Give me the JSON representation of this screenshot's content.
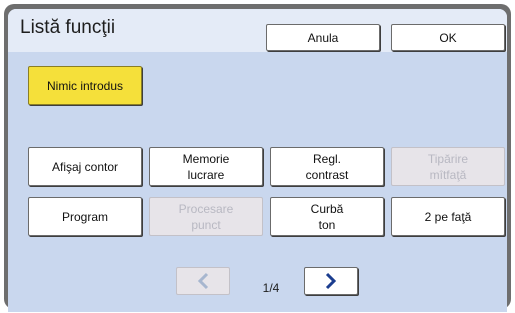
{
  "header": {
    "title": "Listă funcţii",
    "cancel_label": "Anula",
    "ok_label": "OK"
  },
  "status": {
    "nothing_entered_label": "Nimic introdus"
  },
  "functions": [
    {
      "label": "Afişaj contor",
      "enabled": true
    },
    {
      "label": "Memorie\nlucrare",
      "enabled": true
    },
    {
      "label": "Regl.\ncontrast",
      "enabled": true
    },
    {
      "label": "Tipărire\nmîtfaţă",
      "enabled": false
    },
    {
      "label": "Program",
      "enabled": true
    },
    {
      "label": "Procesare\npunct",
      "enabled": false
    },
    {
      "label": "Curbă\nton",
      "enabled": true
    },
    {
      "label": "2 pe faţă",
      "enabled": true
    }
  ],
  "pager": {
    "page_label": "1/4",
    "prev_icon": "chevron-left-icon",
    "next_icon": "chevron-right-icon"
  },
  "colors": {
    "accent_yellow": "#f5e03a",
    "panel_bg": "#c9d7ee",
    "arrow_blue": "#1b3d8f",
    "arrow_disabled": "#a7b6cf"
  }
}
